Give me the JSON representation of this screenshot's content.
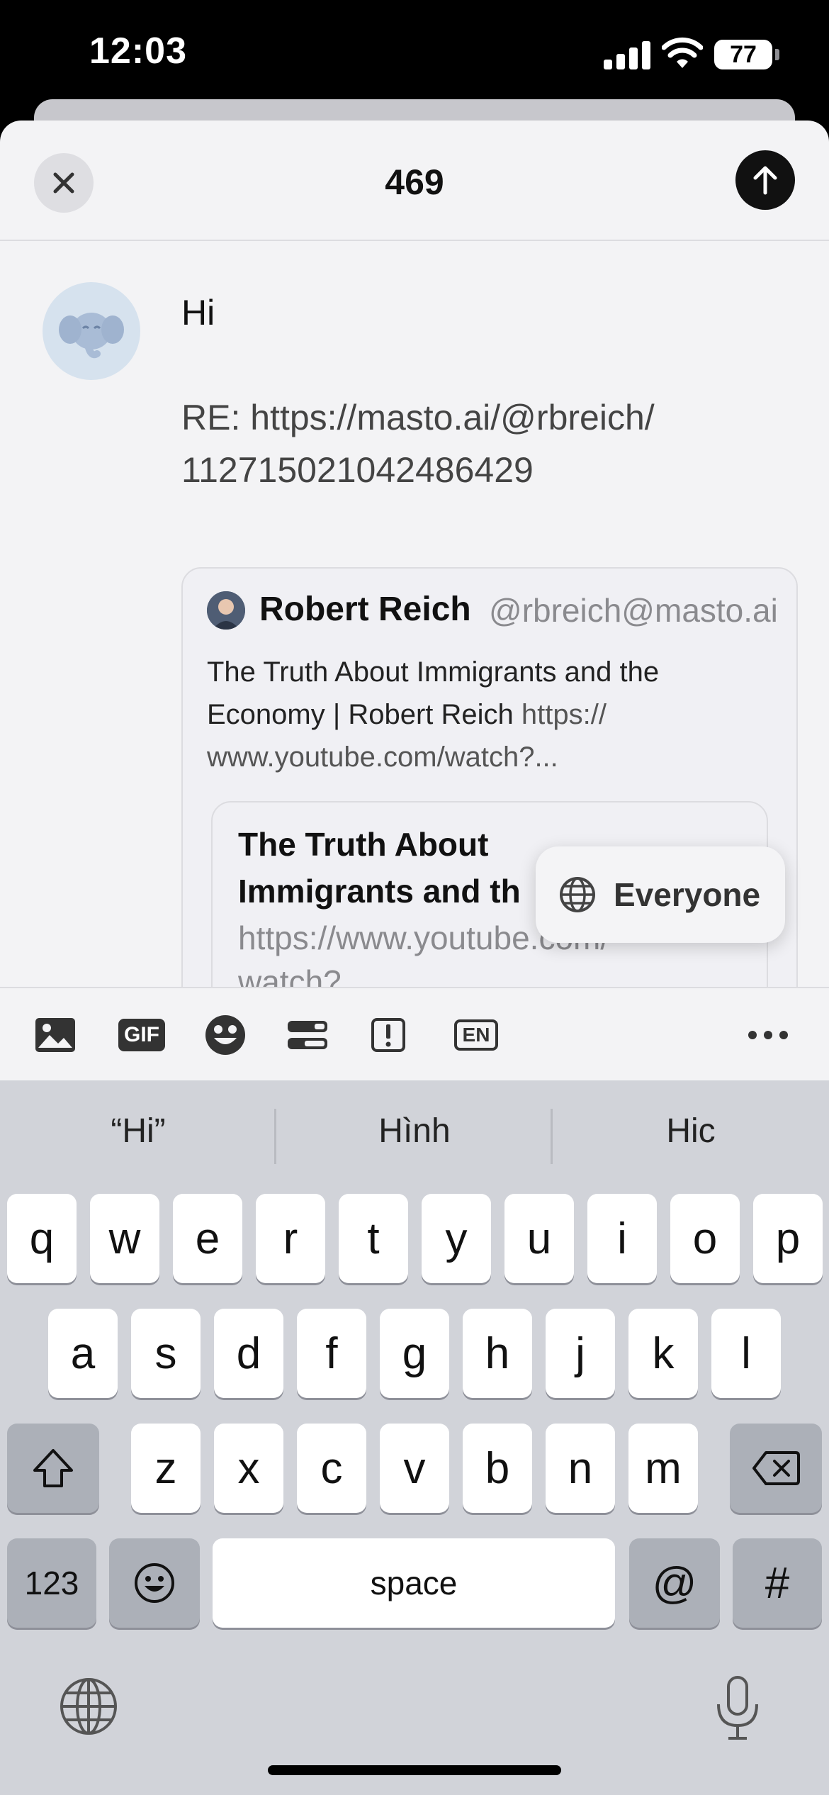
{
  "status_bar": {
    "time": "12:03",
    "battery": "77"
  },
  "nav": {
    "char_count": "469"
  },
  "compose": {
    "line1": "Hi",
    "line2": "RE: https://masto.ai/@rbreich/",
    "line3": "112715021042486429"
  },
  "quote": {
    "author_name": "Robert Reich",
    "author_handle": "@rbreich@masto.ai",
    "text_line1": "The Truth About Immigrants and the",
    "text_line2_a": "Economy | Robert Reich ",
    "text_line2_b": "https://",
    "text_line3": "www.youtube.com/watch?...",
    "link_title_line1": "The Truth About",
    "link_title_line2": "Immigrants and th",
    "link_url_line1": "https://www.youtube.com/",
    "link_url_line2": "watch?"
  },
  "audience": {
    "label": "Everyone"
  },
  "toolbar": {
    "gif_label": "GIF",
    "language_label": "EN",
    "icons": [
      "image-icon",
      "gif-icon",
      "emoji-icon",
      "poll-icon",
      "content-warning-icon",
      "language-icon",
      "more-icon"
    ]
  },
  "keyboard": {
    "suggestions": [
      "“Hi”",
      "Hình",
      "Hic"
    ],
    "row1": [
      "q",
      "w",
      "e",
      "r",
      "t",
      "y",
      "u",
      "i",
      "o",
      "p"
    ],
    "row2": [
      "a",
      "s",
      "d",
      "f",
      "g",
      "h",
      "j",
      "k",
      "l"
    ],
    "row3": [
      "z",
      "x",
      "c",
      "v",
      "b",
      "n",
      "m"
    ],
    "numbers_label": "123",
    "space_label": "space",
    "at_label": "@",
    "hash_label": "#"
  }
}
